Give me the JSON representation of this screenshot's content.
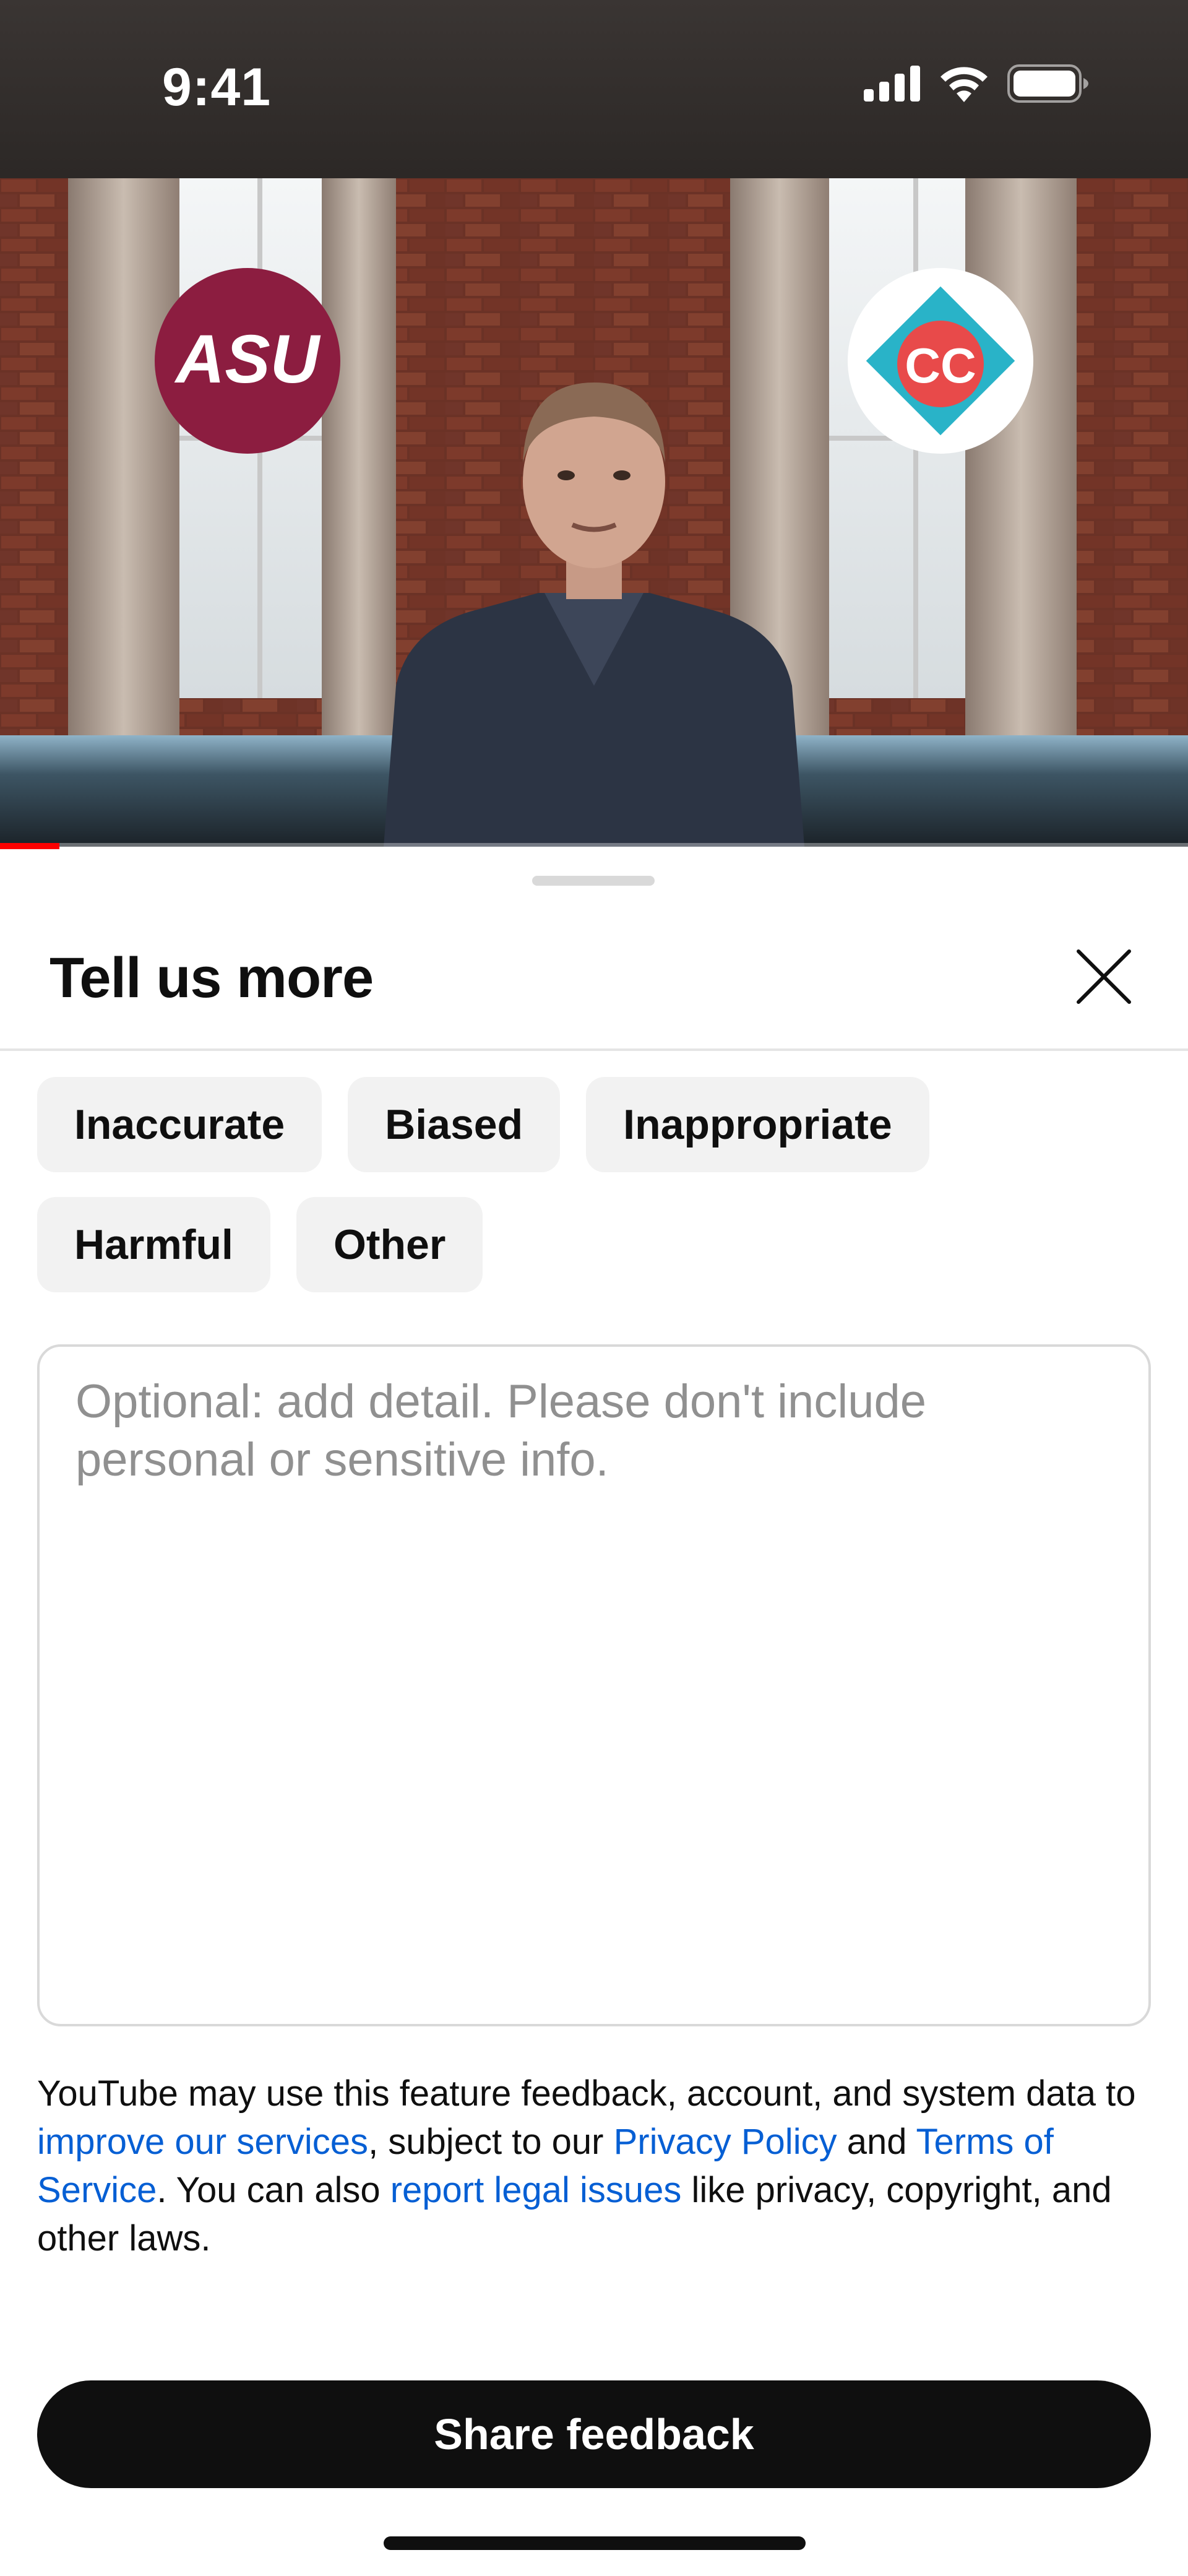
{
  "status_bar": {
    "time": "9:41",
    "icons": [
      "signal-icon",
      "wifi-icon",
      "battery-icon"
    ]
  },
  "video": {
    "left_logo_text": "ASU",
    "right_logo_text": "CC",
    "progress": 0.05,
    "progress_color": "#ff0000"
  },
  "sheet": {
    "title": "Tell us more",
    "close_icon": "close-icon",
    "chips": [
      [
        "Inaccurate",
        "Biased",
        "Inappropriate"
      ],
      [
        "Harmful",
        "Other"
      ]
    ],
    "detail_input": {
      "value": "",
      "placeholder": "Optional: add detail. Please don't include personal or sensitive info."
    },
    "legal": {
      "text_1": "YouTube may use this feature feedback, account, and system data to ",
      "link_1": "improve our services",
      "text_2": ", subject to our ",
      "link_2": "Privacy Policy",
      "text_3": " and ",
      "link_3": "Terms of Service",
      "text_4": ". You can also ",
      "link_4": "report legal issues",
      "text_5": " like privacy, copyright, and other laws."
    },
    "submit_label": "Share feedback"
  },
  "colors": {
    "link": "#065fd4",
    "primary_button": "#0f0f0f",
    "chip_bg": "#f2f2f2",
    "asu_maroon": "#8c1d40"
  }
}
